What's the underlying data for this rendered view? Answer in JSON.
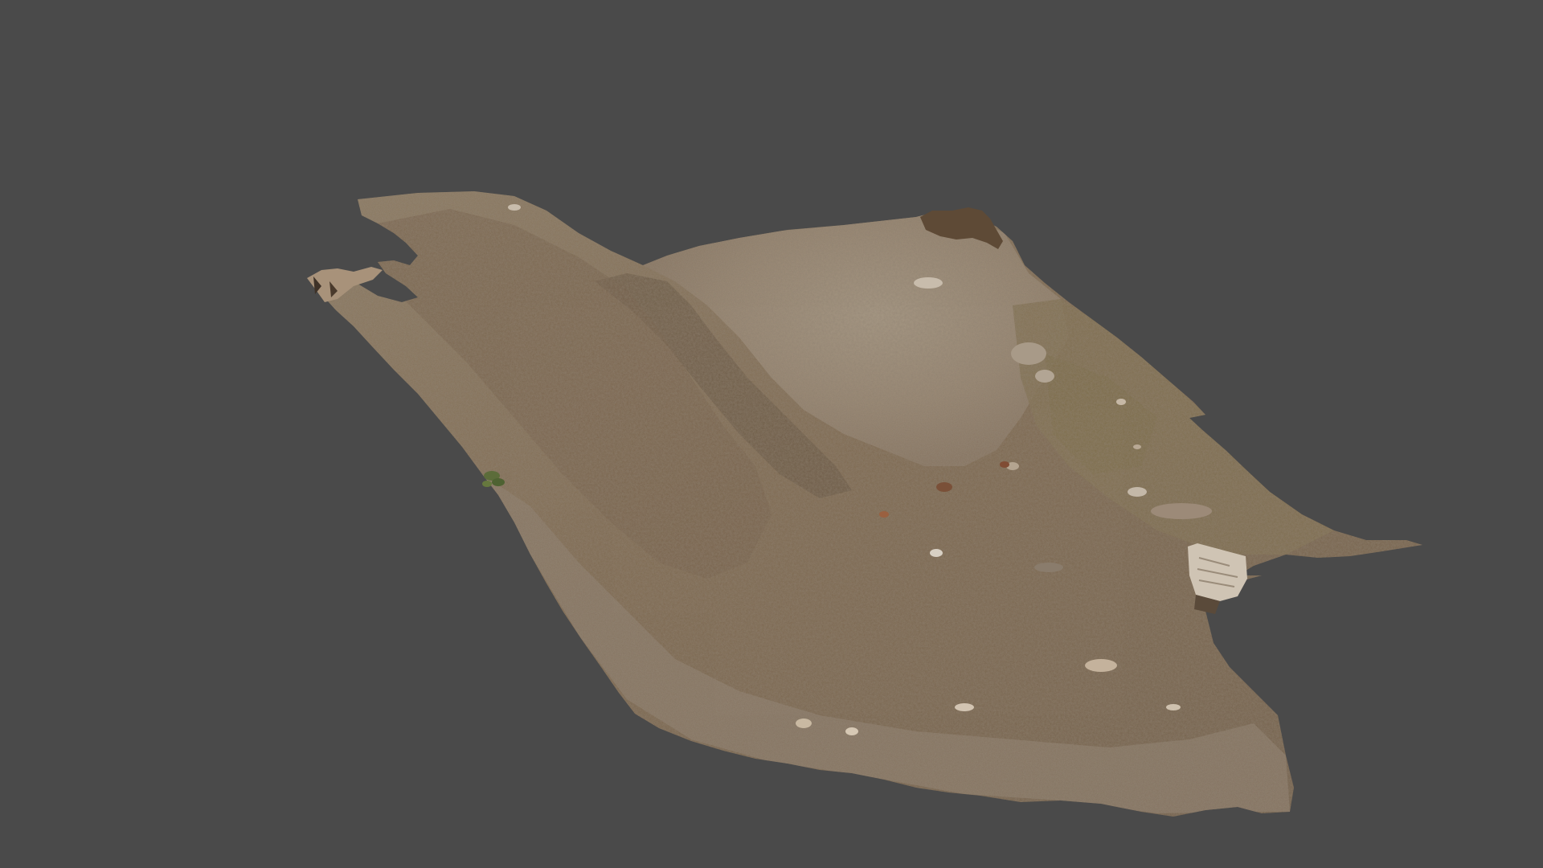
{
  "viewport": {
    "background_color": "#4a4a4a",
    "object": {
      "kind": "photogrammetry-terrain-scan",
      "colors": {
        "soil_base": "#7e6a52",
        "soil_dark": "#5e4c38",
        "soil_light": "#9c8a74",
        "mound_pale": "#a0907c",
        "leaf_litter": "#8a7a68",
        "mossy_patch": "#7a6a48",
        "wood_block": "#cfc4b4"
      }
    }
  }
}
